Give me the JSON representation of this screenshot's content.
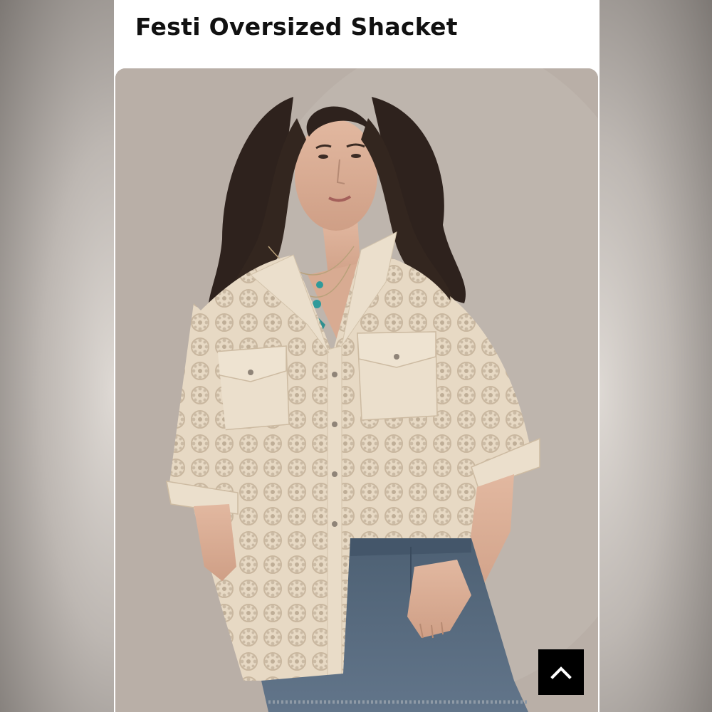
{
  "product": {
    "title": "Festi Oversized Shacket"
  },
  "photo": {
    "alt": "Model wearing a cream eyelet lace oversized shirt jacket with denim shorts"
  },
  "scroll_to_top": {
    "icon": "chevron-up-icon"
  },
  "colors": {
    "title": "#111111",
    "button_bg": "#000000",
    "button_icon": "#ffffff",
    "photo_bg": "#b9afa7",
    "shirt": "#e9dcc8",
    "denim": "#55677a"
  }
}
